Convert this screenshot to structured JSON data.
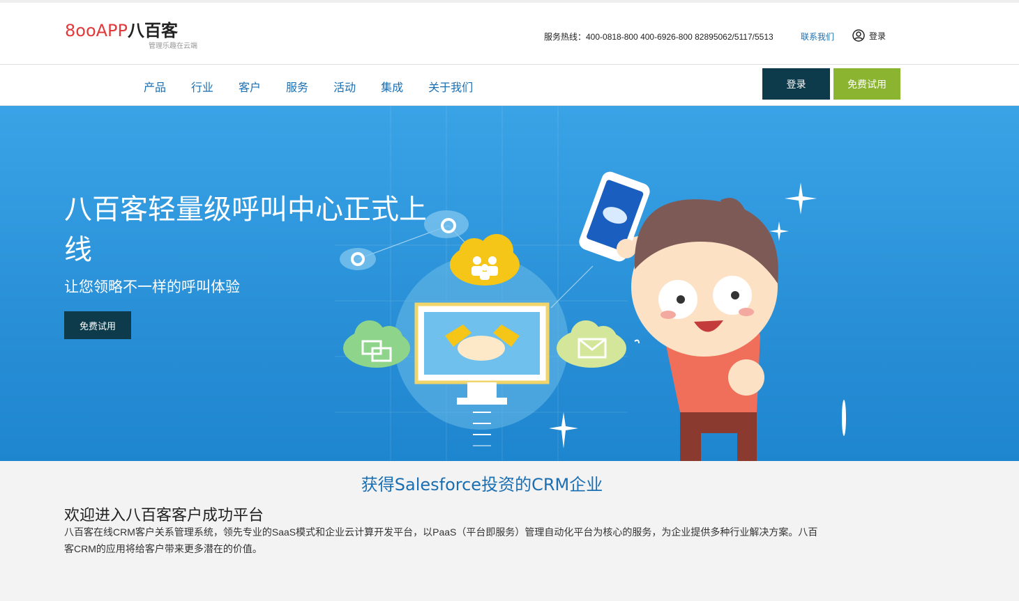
{
  "header": {
    "logo_text": "8ooAPP",
    "logo_cn": "八百客",
    "logo_slogan": "管理乐趣在云端",
    "hotline": "服务热线：400-0818-800  400-6926-800 82895062/5117/5513",
    "contact": "联系我们",
    "login": "登录"
  },
  "nav": {
    "items": [
      {
        "label": "产品"
      },
      {
        "label": "行业"
      },
      {
        "label": "客户"
      },
      {
        "label": "服务"
      },
      {
        "label": "活动"
      },
      {
        "label": "集成"
      },
      {
        "label": "关于我们"
      }
    ],
    "login_button": "登录",
    "trial_button": "免费试用"
  },
  "hero": {
    "title": "八百客轻量级呼叫中心正式上线",
    "subtitle": "让您领略不一样的呼叫体验",
    "button": "免费试用"
  },
  "main": {
    "tagline": "获得Salesforce投资的CRM企业",
    "welcome_title": "欢迎进入八百客客户成功平台",
    "welcome_text": "八百客在线CRM客户关系管理系统，领先专业的SaaS模式和企业云计算开发平台，以PaaS（平台即服务）管理自动化平台为核心的服务，为企业提供多种行业解决方案。八百客CRM的应用将给客户带来更多潜在的价值。"
  },
  "colors": {
    "brand_blue": "#1a6fb3",
    "dark_button": "#0d3b4c",
    "trial_green": "#8bb431",
    "hero_blue": "#2a91d8"
  },
  "icons": [
    "user-icon",
    "cloud-people-icon",
    "chat-icon",
    "mail-icon",
    "handshake-icon",
    "phone-icon"
  ]
}
